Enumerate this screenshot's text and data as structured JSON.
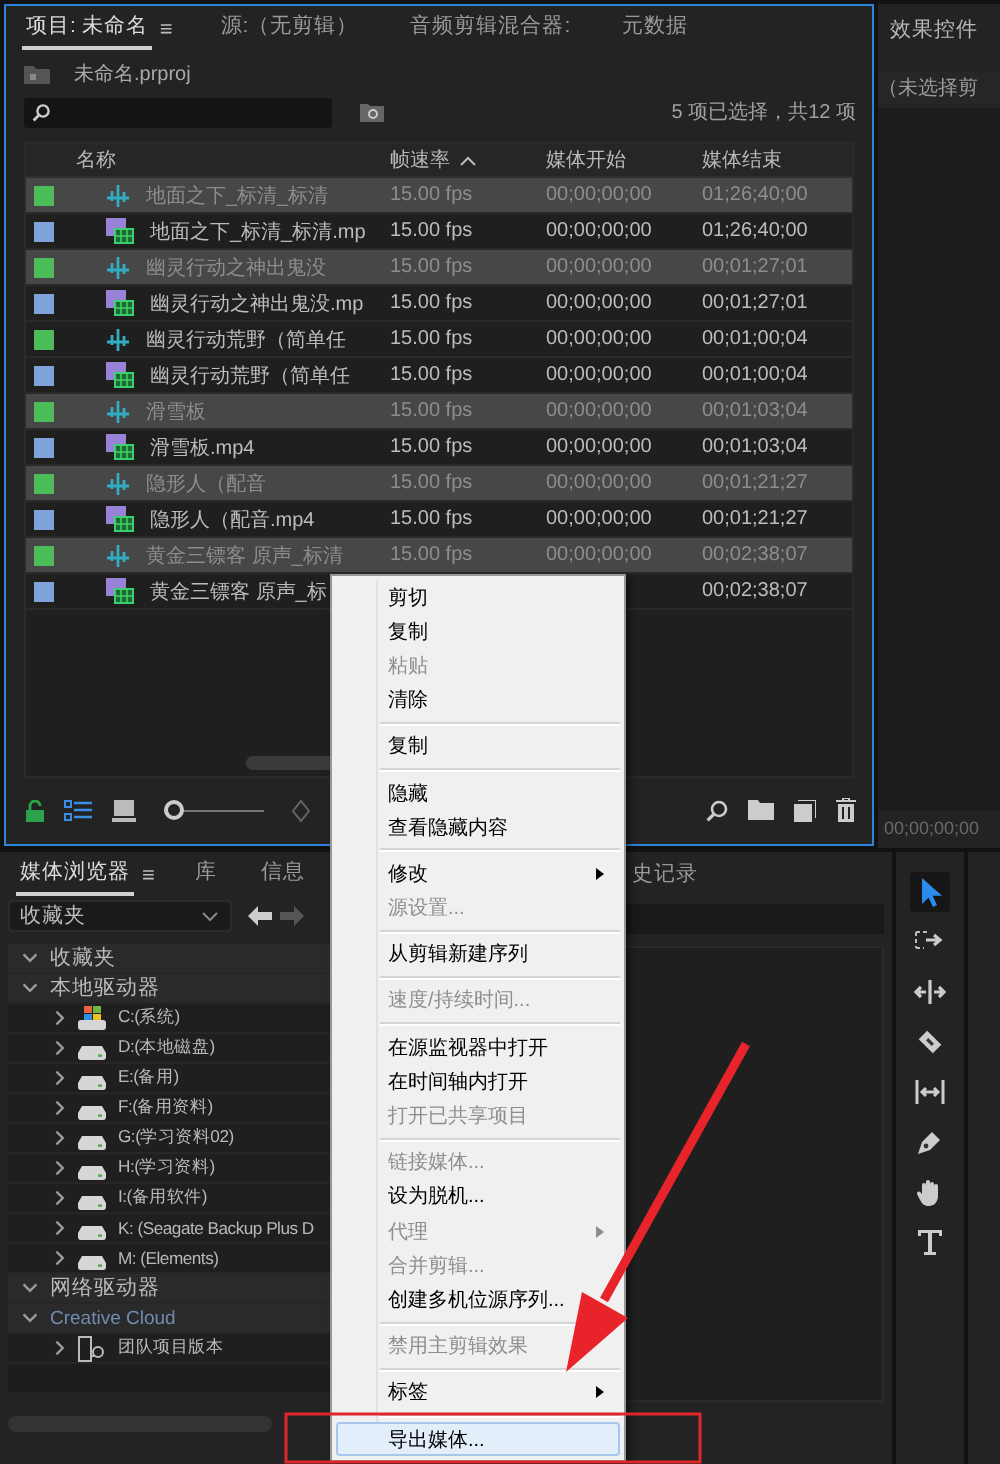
{
  "project_panel": {
    "tabs": [
      {
        "label": "项目: 未命名",
        "selected": true,
        "menu_icon": "≡"
      },
      {
        "label": "源:（无剪辑）",
        "selected": false
      },
      {
        "label": "音频剪辑混合器:",
        "selected": false
      },
      {
        "label": "元数据",
        "selected": false
      }
    ],
    "project_file": "未命名.prproj",
    "selection_info": "5 项已选择，共12 项",
    "columns": [
      {
        "label": "名称",
        "sorted": false
      },
      {
        "label": "帧速率",
        "sorted": true
      },
      {
        "label": "媒体开始",
        "sorted": false
      },
      {
        "label": "媒体结束",
        "sorted": false
      }
    ],
    "rows": [
      {
        "kind": "audio",
        "color": "#4cbb5a",
        "name": "地面之下_标清_标清",
        "fps": "15.00 fps",
        "start": "00;00;00;00",
        "end": "01;26;40;00",
        "selected": true
      },
      {
        "kind": "video",
        "color": "#7fa3d9",
        "name": "地面之下_标清_标清.mp",
        "fps": "15.00 fps",
        "start": "00;00;00;00",
        "end": "01;26;40;00",
        "selected": false
      },
      {
        "kind": "audio",
        "color": "#4cbb5a",
        "name": "幽灵行动之神出鬼没",
        "fps": "15.00 fps",
        "start": "00;00;00;00",
        "end": "00;01;27;01",
        "selected": true
      },
      {
        "kind": "video",
        "color": "#7fa3d9",
        "name": "幽灵行动之神出鬼没.mp",
        "fps": "15.00 fps",
        "start": "00;00;00;00",
        "end": "00;01;27;01",
        "selected": false
      },
      {
        "kind": "audio",
        "color": "#4cbb5a",
        "name": "幽灵行动荒野（简单任",
        "fps": "15.00 fps",
        "start": "00;00;00;00",
        "end": "00;01;00;04",
        "selected": false
      },
      {
        "kind": "video",
        "color": "#7fa3d9",
        "name": "幽灵行动荒野（简单任",
        "fps": "15.00 fps",
        "start": "00;00;00;00",
        "end": "00;01;00;04",
        "selected": false
      },
      {
        "kind": "audio",
        "color": "#4cbb5a",
        "name": "滑雪板",
        "fps": "15.00 fps",
        "start": "00;00;00;00",
        "end": "00;01;03;04",
        "selected": true
      },
      {
        "kind": "video",
        "color": "#7fa3d9",
        "name": "滑雪板.mp4",
        "fps": "15.00 fps",
        "start": "00;00;00;00",
        "end": "00;01;03;04",
        "selected": false
      },
      {
        "kind": "audio",
        "color": "#4cbb5a",
        "name": "隐形人（配音",
        "fps": "15.00 fps",
        "start": "00;00;00;00",
        "end": "00;01;21;27",
        "selected": true
      },
      {
        "kind": "video",
        "color": "#7fa3d9",
        "name": "隐形人（配音.mp4",
        "fps": "15.00 fps",
        "start": "00;00;00;00",
        "end": "00;01;21;27",
        "selected": false
      },
      {
        "kind": "audio",
        "color": "#4cbb5a",
        "name": "黄金三镖客 原声_标清",
        "fps": "15.00 fps",
        "start": "00;00;00;00",
        "end": "00;02;38;07",
        "selected": true
      },
      {
        "kind": "video",
        "color": "#7fa3d9",
        "name": "黄金三镖客 原声_标",
        "end": "00;02;38;07",
        "selected": false
      }
    ],
    "views": [
      {
        "kind": "list",
        "selected": true
      },
      {
        "kind": "icon",
        "selected": false
      }
    ],
    "zoom_slider": {
      "level": 0
    }
  },
  "effects_panel": {
    "title": "效果控件",
    "clip_info": "（未选择剪",
    "timecode": "00;00;00;00"
  },
  "media_browser": {
    "tabs": [
      {
        "label": "媒体浏览器",
        "selected": true,
        "menu_icon": "≡"
      },
      {
        "label": "库",
        "selected": false
      },
      {
        "label": "信息",
        "selected": false
      }
    ],
    "location": "收藏夹",
    "tree": [
      {
        "kind": "section",
        "label": "收藏夹",
        "expanded": true
      },
      {
        "kind": "section",
        "label": "本地驱动器",
        "expanded": true,
        "children": [
          {
            "kind": "system-drive",
            "label": "C:(系统)",
            "expanded": false
          },
          {
            "kind": "drive",
            "label": "D:(本地磁盘)",
            "expanded": false
          },
          {
            "kind": "drive",
            "label": "E:(备用)",
            "expanded": false
          },
          {
            "kind": "drive",
            "label": "F:(备用资料)",
            "expanded": false
          },
          {
            "kind": "drive",
            "label": "G:(学习资料02)",
            "expanded": false
          },
          {
            "kind": "drive",
            "label": "H:(学习资料)",
            "expanded": false
          },
          {
            "kind": "drive",
            "label": "I:(备用软件)",
            "expanded": false
          },
          {
            "kind": "drive",
            "label": "K: (Seagate Backup Plus D",
            "expanded": false
          },
          {
            "kind": "drive",
            "label": "M: (Elements)",
            "expanded": false
          }
        ]
      },
      {
        "kind": "section",
        "label": "网络驱动器",
        "expanded": true
      },
      {
        "kind": "cloud",
        "label": "Creative Cloud",
        "expanded": true,
        "children": [
          {
            "kind": "team-project",
            "label": "团队项目版本",
            "expanded": false
          }
        ]
      }
    ]
  },
  "history_panel": {
    "tab": "史记录"
  },
  "tools": [
    {
      "kind": "selection",
      "selected": true
    },
    {
      "kind": "track-select",
      "selected": false
    },
    {
      "kind": "ripple",
      "selected": false
    },
    {
      "kind": "razor",
      "selected": false
    },
    {
      "kind": "slip",
      "selected": false
    },
    {
      "kind": "pen",
      "selected": false
    },
    {
      "kind": "hand",
      "selected": false
    },
    {
      "kind": "type",
      "selected": false
    }
  ],
  "context_menu": {
    "groups": [
      [
        {
          "label": "剪切",
          "disabled": false,
          "has_submenu": false,
          "selected": false
        },
        {
          "label": "复制",
          "disabled": false,
          "has_submenu": false,
          "selected": false
        },
        {
          "label": "粘贴",
          "disabled": true,
          "has_submenu": false,
          "selected": false
        },
        {
          "label": "清除",
          "disabled": false,
          "has_submenu": false,
          "selected": false
        }
      ],
      [
        {
          "label": "复制",
          "disabled": false,
          "has_submenu": false,
          "selected": false
        }
      ],
      [
        {
          "label": "隐藏",
          "disabled": false,
          "has_submenu": false,
          "selected": false
        },
        {
          "label": "查看隐藏内容",
          "disabled": false,
          "has_submenu": false,
          "selected": false
        }
      ],
      [
        {
          "label": "修改",
          "disabled": false,
          "has_submenu": true,
          "selected": false
        },
        {
          "label": "源设置...",
          "disabled": true,
          "has_submenu": false,
          "selected": false
        }
      ],
      [
        {
          "label": "从剪辑新建序列",
          "disabled": false,
          "has_submenu": false,
          "selected": false
        }
      ],
      [
        {
          "label": "速度/持续时间...",
          "disabled": true,
          "has_submenu": false,
          "selected": false
        }
      ],
      [
        {
          "label": "在源监视器中打开",
          "disabled": false,
          "has_submenu": false,
          "selected": false
        },
        {
          "label": "在时间轴内打开",
          "disabled": false,
          "has_submenu": false,
          "selected": false
        },
        {
          "label": "打开已共享项目",
          "disabled": true,
          "has_submenu": false,
          "selected": false
        }
      ],
      [
        {
          "label": "链接媒体...",
          "disabled": true,
          "has_submenu": false,
          "selected": false
        },
        {
          "label": "设为脱机...",
          "disabled": false,
          "has_submenu": false,
          "selected": false
        },
        {
          "label": "代理",
          "disabled": true,
          "has_submenu": true,
          "selected": false
        },
        {
          "label": "合并剪辑...",
          "disabled": true,
          "has_submenu": false,
          "selected": false
        },
        {
          "label": "创建多机位源序列...",
          "disabled": false,
          "has_submenu": false,
          "selected": false
        }
      ],
      [
        {
          "label": "禁用主剪辑效果",
          "disabled": true,
          "has_submenu": false,
          "selected": false
        }
      ],
      [
        {
          "label": "标签",
          "disabled": false,
          "has_submenu": true,
          "selected": false
        }
      ],
      [
        {
          "label": "导出媒体...",
          "disabled": false,
          "has_submenu": false,
          "selected": true
        }
      ]
    ]
  }
}
